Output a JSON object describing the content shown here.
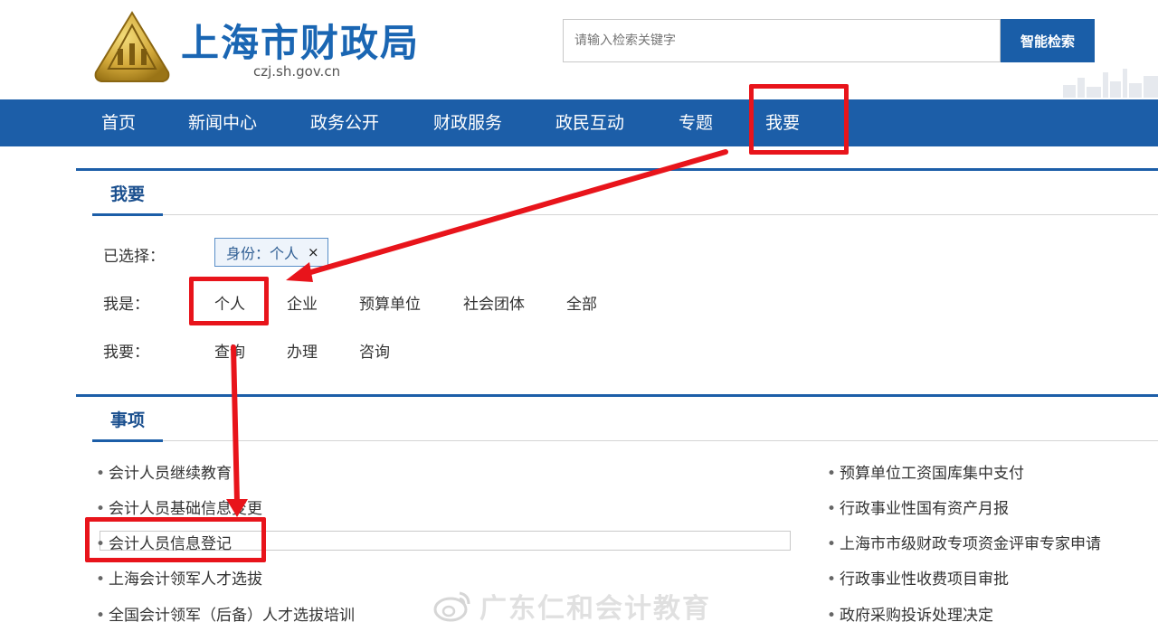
{
  "header": {
    "site_title": "上海市财政局",
    "site_domain": "czj.sh.gov.cn",
    "search_placeholder": "请输入检索关键字",
    "search_button": "智能检索"
  },
  "nav": {
    "items": [
      "首页",
      "新闻中心",
      "政务公开",
      "财政服务",
      "政民互动",
      "专题",
      "我要"
    ]
  },
  "filter_section": {
    "title": "我要",
    "selected_label": "已选择：",
    "selected_chip": "身份：个人",
    "chip_close": "×",
    "identity_label": "我是：",
    "identity_options": [
      "个人",
      "企业",
      "预算单位",
      "社会团体",
      "全部"
    ],
    "action_label": "我要：",
    "action_options": [
      "查询",
      "办理",
      "咨询"
    ]
  },
  "items_section": {
    "title": "事项",
    "left_items": [
      "会计人员继续教育",
      "会计人员基础信息变更",
      "会计人员信息登记",
      "上海会计领军人才选拔",
      "全国会计领军（后备）人才选拔培训"
    ],
    "right_items": [
      "预算单位工资国库集中支付",
      "行政事业性国有资产月报",
      "上海市市级财政专项资金评审专家申请",
      "行政事业性收费项目审批",
      "政府采购投诉处理决定"
    ]
  },
  "watermark": {
    "text": "广东仁和会计教育"
  },
  "colors": {
    "brand_blue": "#1c5ea8",
    "annotation_red": "#e8141b",
    "logo_gold": "#c9a227"
  }
}
